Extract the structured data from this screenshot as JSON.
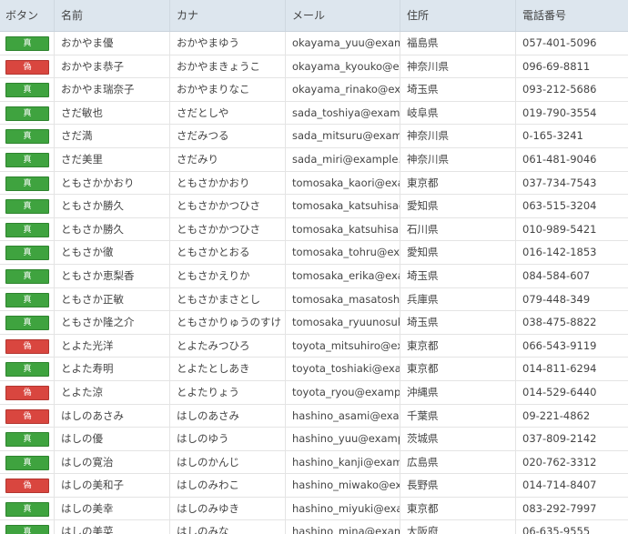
{
  "columns": [
    "ボタン",
    "名前",
    "カナ",
    "メール",
    "住所",
    "電話番号"
  ],
  "button_labels": {
    "true": "真",
    "false": "偽"
  },
  "colors": {
    "true": "#3fa33f",
    "false": "#d9463f",
    "header": "#dde6ee"
  },
  "rows": [
    {
      "flag": true,
      "name": "おかやま優",
      "kana": "おかやまゆう",
      "email": "okayama_yuu@example",
      "address": "福島県",
      "phone": "057-401-5096"
    },
    {
      "flag": false,
      "name": "おかやま恭子",
      "kana": "おかやまきょうこ",
      "email": "okayama_kyouko@exam",
      "address": "神奈川県",
      "phone": "096-69-8811"
    },
    {
      "flag": true,
      "name": "おかやま瑞奈子",
      "kana": "おかやまりなこ",
      "email": "okayama_rinako@examp",
      "address": "埼玉県",
      "phone": "093-212-5686"
    },
    {
      "flag": true,
      "name": "さだ敏也",
      "kana": "さだとしや",
      "email": "sada_toshiya@example.",
      "address": "岐阜県",
      "phone": "019-790-3554"
    },
    {
      "flag": true,
      "name": "さだ満",
      "kana": "さだみつる",
      "email": "sada_mitsuru@example",
      "address": "神奈川県",
      "phone": "0-165-3241"
    },
    {
      "flag": true,
      "name": "さだ美里",
      "kana": "さだみり",
      "email": "sada_miri@example.com",
      "address": "神奈川県",
      "phone": "061-481-9046"
    },
    {
      "flag": true,
      "name": "ともさかかおり",
      "kana": "ともさかかおり",
      "email": "tomosaka_kaori@exam",
      "address": "東京都",
      "phone": "037-734-7543"
    },
    {
      "flag": true,
      "name": "ともさか勝久",
      "kana": "ともさかかつひさ",
      "email": "tomosaka_katsuhisa@ex",
      "address": "愛知県",
      "phone": "063-515-3204"
    },
    {
      "flag": true,
      "name": "ともさか勝久",
      "kana": "ともさかかつひさ",
      "email": "tomosaka_katsuhisa1@e",
      "address": "石川県",
      "phone": "010-989-5421"
    },
    {
      "flag": true,
      "name": "ともさか徹",
      "kana": "ともさかとおる",
      "email": "tomosaka_tohru@examp",
      "address": "愛知県",
      "phone": "016-142-1853"
    },
    {
      "flag": true,
      "name": "ともさか恵梨香",
      "kana": "ともさかえりか",
      "email": "tomosaka_erika@examp",
      "address": "埼玉県",
      "phone": "084-584-607"
    },
    {
      "flag": true,
      "name": "ともさか正敏",
      "kana": "ともさかまさとし",
      "email": "tomosaka_masatoshi@e",
      "address": "兵庫県",
      "phone": "079-448-349"
    },
    {
      "flag": true,
      "name": "ともさか隆之介",
      "kana": "ともさかりゅうのすけ",
      "email": "tomosaka_ryuunosuke@",
      "address": "埼玉県",
      "phone": "038-475-8822"
    },
    {
      "flag": false,
      "name": "とよた光洋",
      "kana": "とよたみつひろ",
      "email": "toyota_mitsuhiro@exam",
      "address": "東京都",
      "phone": "066-543-9119"
    },
    {
      "flag": true,
      "name": "とよた寿明",
      "kana": "とよたとしあき",
      "email": "toyota_toshiaki@examp",
      "address": "東京都",
      "phone": "014-811-6294"
    },
    {
      "flag": false,
      "name": "とよた涼",
      "kana": "とよたりょう",
      "email": "toyota_ryou@example.c",
      "address": "沖縄県",
      "phone": "014-529-6440"
    },
    {
      "flag": false,
      "name": "はしのあさみ",
      "kana": "はしのあさみ",
      "email": "hashino_asami@exampl",
      "address": "千葉県",
      "phone": "09-221-4862"
    },
    {
      "flag": true,
      "name": "はしの優",
      "kana": "はしのゆう",
      "email": "hashino_yuu@example.",
      "address": "茨城県",
      "phone": "037-809-2142"
    },
    {
      "flag": true,
      "name": "はしの寛治",
      "kana": "はしのかんじ",
      "email": "hashino_kanji@exampl",
      "address": "広島県",
      "phone": "020-762-3312"
    },
    {
      "flag": false,
      "name": "はしの美和子",
      "kana": "はしのみわこ",
      "email": "hashino_miwako@exam",
      "address": "長野県",
      "phone": "014-714-8407"
    },
    {
      "flag": true,
      "name": "はしの美幸",
      "kana": "はしのみゆき",
      "email": "hashino_miyuki@exam",
      "address": "東京都",
      "phone": "083-292-7997"
    },
    {
      "flag": true,
      "name": "はしの美菜",
      "kana": "はしのみな",
      "email": "hashino_mina@example",
      "address": "大阪府",
      "phone": "06-635-9555"
    }
  ]
}
